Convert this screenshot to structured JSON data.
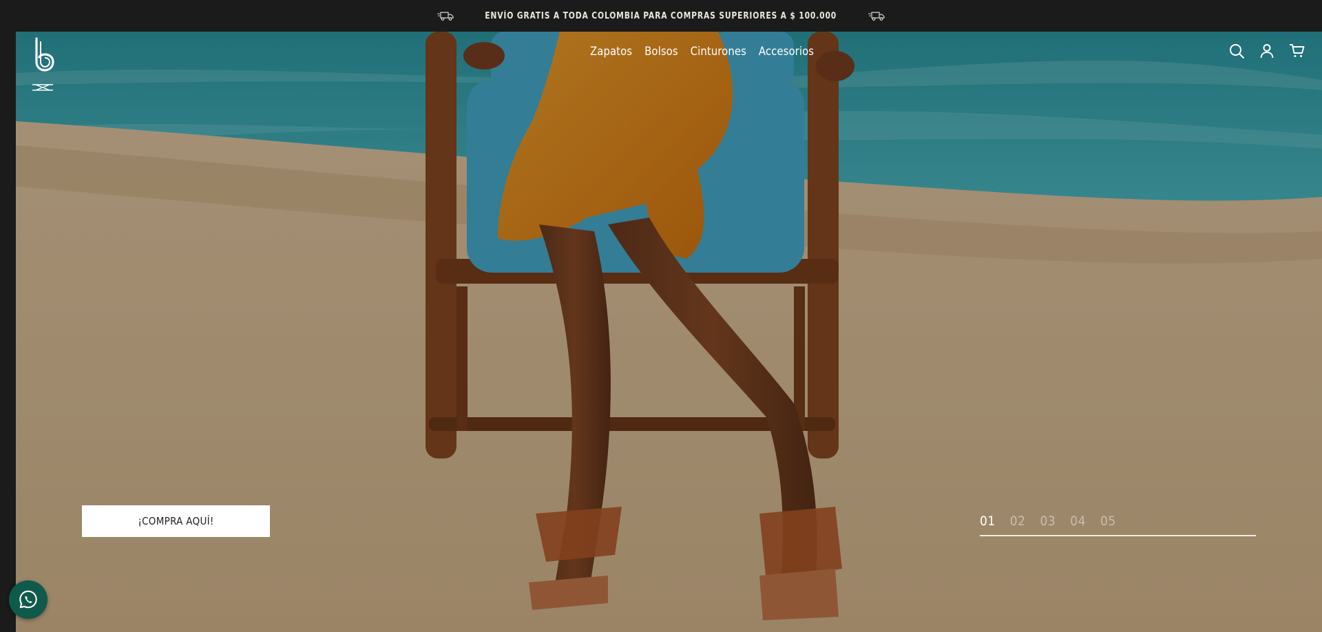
{
  "announcement": {
    "text": "ENVÍO GRATIS A TODA COLOMBIA PARA COMPRAS SUPERIORES A $ 100.000",
    "icon_left": "truck-icon",
    "icon_right": "truck-icon"
  },
  "header": {
    "logo": "b",
    "menu_icon": "menu-icon",
    "nav": [
      "Zapatos",
      "Bolsos",
      "Cinturones",
      "Accesorios"
    ],
    "icons": [
      "search-icon",
      "user-icon",
      "cart-icon"
    ]
  },
  "hero": {
    "cta_label": "¡COMPRA AQUÍ!",
    "slides": [
      "01",
      "02",
      "03",
      "04",
      "05"
    ],
    "active_slide": "01"
  },
  "floating": {
    "whatsapp_icon": "whatsapp-icon"
  },
  "colors": {
    "topbar": "#1b1b1b",
    "pool": "#3fb2bf",
    "dress": "#e88a1f",
    "cushion": "#4cb3d3",
    "whatsapp": "#0f5a4a"
  }
}
